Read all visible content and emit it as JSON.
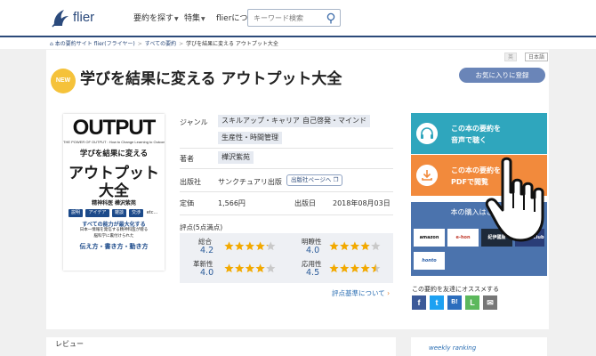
{
  "header": {
    "logo_text": "flier",
    "nav": [
      "要約を探す",
      "特集",
      "flierについて"
    ],
    "search_placeholder": "キーワード検索"
  },
  "breadcrumb": {
    "items": [
      "本の要約サイト flier(フライヤー)",
      "すべての要約"
    ],
    "current": "学びを結果に変える アウトプット大全"
  },
  "lang": {
    "en": "英",
    "ja": "日本語"
  },
  "book": {
    "badge": "NEW",
    "title": "学びを結果に変える アウトプット大全",
    "favorite_button": "お気に入りに登録"
  },
  "cover": {
    "big": "OUTPUT",
    "sub": "THE POWER OF OUTPUT : How to Change Learning to Outcome",
    "line1": "学びを結果に変える",
    "line2": "アウトプット",
    "line3": "大全",
    "author": "精神科医 樺沢紫苑",
    "chips": [
      "説明",
      "アイデア",
      "雑談",
      "交渉",
      "etc..."
    ],
    "l1": "すべての能力が最大化する",
    "l2": "日本一情報を発信する精神科医が贈る",
    "l3": "脳科学に裏付けられた",
    "l4": "伝え方・書き方・動き方"
  },
  "info": {
    "genre_label": "ジャンル",
    "genres": [
      "スキルアップ・キャリア",
      "自己啓発・マインド",
      "生産性・時間管理"
    ],
    "author_label": "著者",
    "author": "樺沢紫苑",
    "publisher_label": "出版社",
    "publisher": "サンクチュアリ出版",
    "publisher_page": "出版社ページへ",
    "price_label": "定価",
    "price": "1,566円",
    "date_label": "出版日",
    "date": "2018年08月03日"
  },
  "rating": {
    "heading": "評点(5点満点)",
    "items": [
      {
        "label": "総合",
        "score": "4.2",
        "value": 4.2
      },
      {
        "label": "明瞭性",
        "score": "4.0",
        "value": 4.0
      },
      {
        "label": "革新性",
        "score": "4.0",
        "value": 4.0
      },
      {
        "label": "応用性",
        "score": "4.5",
        "value": 4.5
      }
    ],
    "criteria_link": "評点基準について"
  },
  "side": {
    "audio_1": "この本の要約を",
    "audio_2": "音声で聴く",
    "pdf_1": "この本の要約を",
    "pdf_2": "PDFで閲覧",
    "buy_title": "本の購入はこちら",
    "stores": [
      "amazon",
      "e-hon",
      "紀伊國屋",
      "Honya Club",
      "honto"
    ],
    "share_label": "この要約を友達にオススメする",
    "share_buttons": [
      "f",
      "t",
      "B!",
      "L",
      "✉"
    ]
  },
  "bottom": {
    "review": "レビュー",
    "weekly": "weekly ranking"
  },
  "colors": {
    "accent": "#2c4a7a",
    "audio": "#2fa6bd",
    "pdf": "#f28a3c",
    "buy": "#4b73ad",
    "star": "#f2a900"
  }
}
